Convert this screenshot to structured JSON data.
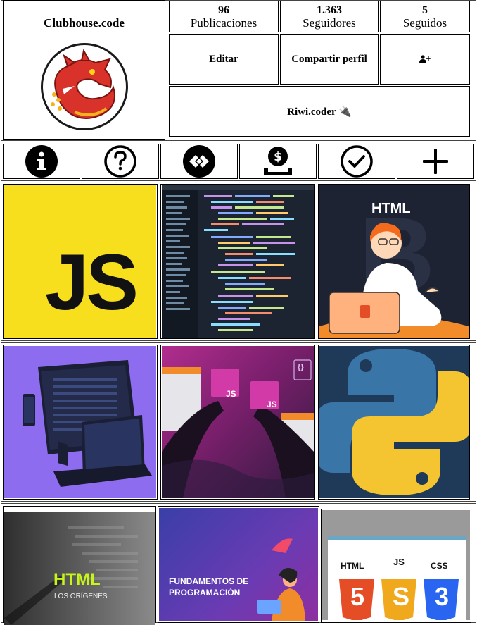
{
  "profile": {
    "username": "Clubhouse.code",
    "logo_icon": "red-dragon-logo"
  },
  "stats": [
    {
      "value": "96",
      "label": "Publicaciones"
    },
    {
      "value": "1.363",
      "label": "Seguidores"
    },
    {
      "value": "5",
      "label": "Seguidos"
    }
  ],
  "actions": {
    "edit_label": "Editar",
    "share_label": "Compartir perfil",
    "add_user_icon": "add-user-icon",
    "bio_text": "Riwi.coder 🔌"
  },
  "highlights": [
    {
      "icon": "info-icon"
    },
    {
      "icon": "question-icon"
    },
    {
      "icon": "link-logo-icon"
    },
    {
      "icon": "money-hand-icon"
    },
    {
      "icon": "check-icon"
    },
    {
      "icon": "plus-icon"
    }
  ],
  "posts": {
    "js_text": "JS",
    "html_text": "HTML",
    "js_badge_1": "JS",
    "js_badge_2": "JS",
    "braces_text": "{}",
    "html_origins_title": "HTML",
    "html_origins_sub": "LOS ORÍGENES",
    "fundamentos_line1": "FUNDAMENTOS DE",
    "fundamentos_line2": "PROGRAMACIÓN",
    "stack_html": "HTML",
    "stack_js": "JS",
    "stack_css": "CSS",
    "stack_html_num": "5",
    "stack_js_num": "S",
    "stack_css_num": "3"
  },
  "colors": {
    "js_yellow": "#f7df1e",
    "code_bg": "#1b2430",
    "html_bg": "#1d2333",
    "purple": "#8e6cf0",
    "magenta": "#a02a8e",
    "python_bg": "#1f3a58",
    "python_blue": "#3a75a8",
    "python_yellow": "#f5c531",
    "html5_orange": "#e44d26",
    "css3_blue": "#2965f1"
  }
}
